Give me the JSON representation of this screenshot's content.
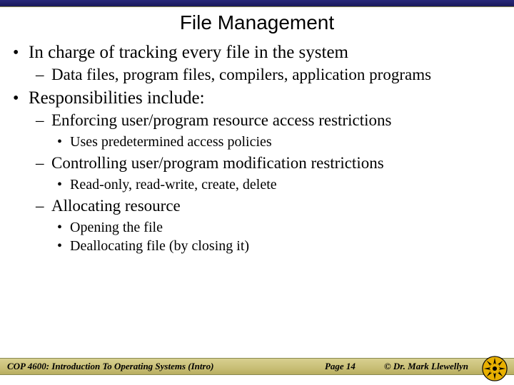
{
  "title": "File Management",
  "bullets": [
    {
      "text": "In charge of tracking every file in the system",
      "children": [
        {
          "text": "Data files, program files, compilers, application programs"
        }
      ]
    },
    {
      "text": "Responsibilities include:",
      "children": [
        {
          "text": "Enforcing user/program resource access restrictions",
          "children": [
            {
              "text": "Uses predetermined access policies"
            }
          ]
        },
        {
          "text": "Controlling user/program modification restrictions",
          "children": [
            {
              "text": "Read-only, read-write, create, delete"
            }
          ]
        },
        {
          "text": "Allocating resource",
          "children": [
            {
              "text": "Opening the file"
            },
            {
              "text": "Deallocating file (by closing it)"
            }
          ]
        }
      ]
    }
  ],
  "footer": {
    "course": "COP 4600: Introduction To Operating Systems (Intro)",
    "page": "Page 14",
    "author": "© Dr. Mark Llewellyn"
  },
  "glyphs": {
    "dot": "•",
    "dash": "–"
  }
}
